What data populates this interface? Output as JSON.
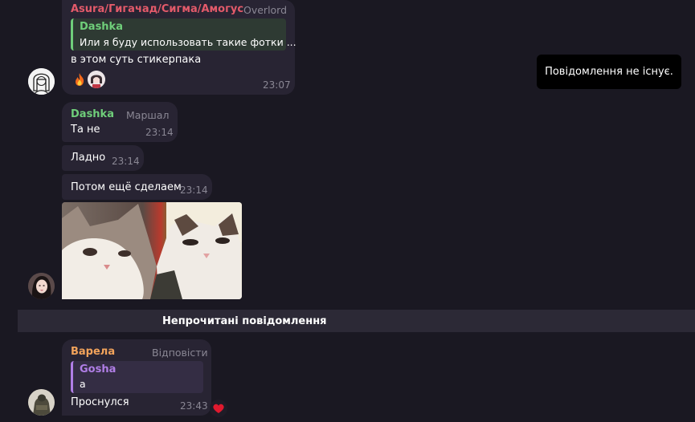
{
  "colors": {
    "background": "#1a1822",
    "bubble": "#282433",
    "name_red": "#e35a6a",
    "name_green": "#6fce7a",
    "name_orange": "#f2a35b",
    "name_purple": "#b07ee6",
    "secondary": "#8a8794"
  },
  "messages": [
    {
      "author": "Asura/Гигачад/Сигма/Амогус",
      "rank": "Overlord",
      "quote_author": "Dashka",
      "quote_text": "Или я буду использовать такие фотки ...",
      "text": "в этом суть стикерпака",
      "reactions": [
        "fire-icon",
        "user-avatar-icon"
      ],
      "time": "23:07"
    },
    {
      "author": "Dashka",
      "rank": "Маршал",
      "text": "Та не",
      "time": "23:14"
    },
    {
      "text": "Ладно",
      "time": "23:14"
    },
    {
      "text": "Потом ещё сделаем",
      "time": "23:14"
    },
    {
      "author": "Варела",
      "rank": "Відповісти",
      "quote_author": "Gosha",
      "quote_text": "а",
      "text": "Проснулся",
      "time": "23:43",
      "reaction": "heart-icon"
    }
  ],
  "tooltip": "Повідомлення не існує.",
  "unread_divider": "Непрочитані повідомлення"
}
